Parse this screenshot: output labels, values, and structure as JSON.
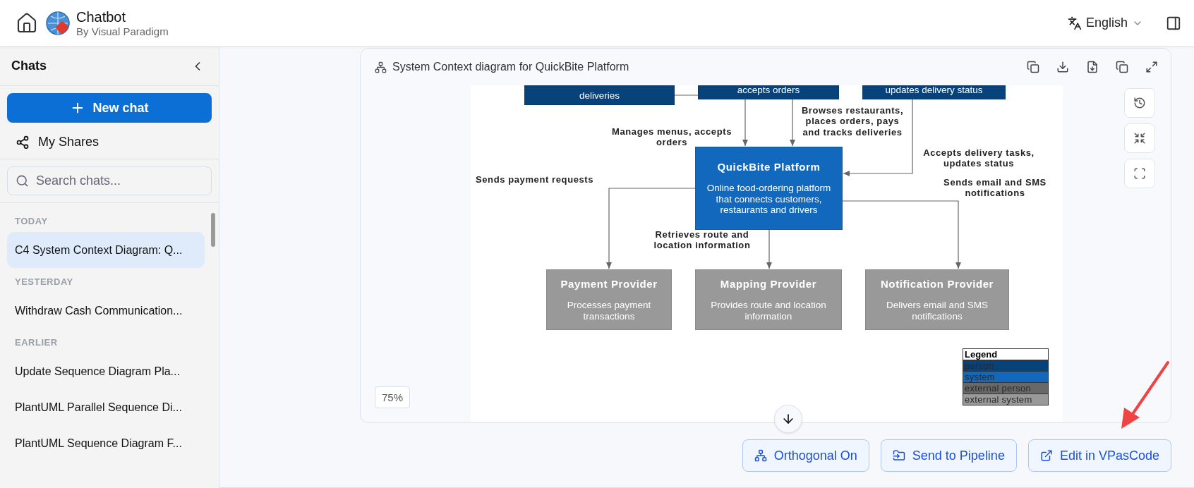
{
  "header": {
    "app_name": "Chatbot",
    "subtitle": "By Visual Paradigm",
    "language": "English"
  },
  "sidebar": {
    "title": "Chats",
    "new_chat": "New chat",
    "my_shares": "My Shares",
    "search": {
      "placeholder": "Search chats..."
    },
    "groups": [
      {
        "label": "TODAY",
        "items": [
          {
            "title": "C4 System Context Diagram: Q...",
            "selected": true
          }
        ]
      },
      {
        "label": "YESTERDAY",
        "items": [
          {
            "title": "Withdraw Cash Communication...",
            "selected": false
          }
        ]
      },
      {
        "label": "EARLIER",
        "items": [
          {
            "title": "Update Sequence Diagram Pla...",
            "selected": false
          },
          {
            "title": "PlantUML Parallel Sequence Di...",
            "selected": false
          },
          {
            "title": "PlantUML Sequence Diagram F...",
            "selected": false
          }
        ]
      }
    ]
  },
  "diagram_card": {
    "title": "System Context diagram for QuickBite Platform",
    "zoom": "75%",
    "nodes": [
      {
        "kind": "person",
        "description": "deliveries"
      },
      {
        "kind": "person",
        "description": "accepts orders"
      },
      {
        "kind": "person",
        "description": "updates delivery status"
      },
      {
        "kind": "system",
        "name": "QuickBite Platform",
        "description": "Online food-ordering platform that connects customers, restaurants and drivers"
      },
      {
        "kind": "external_system",
        "name": "Payment Provider",
        "description": "Processes payment transactions"
      },
      {
        "kind": "external_system",
        "name": "Mapping Provider",
        "description": "Provides route and location information"
      },
      {
        "kind": "external_system",
        "name": "Notification Provider",
        "description": "Delivers email and SMS notifications"
      }
    ],
    "relationships": [
      {
        "label": "Browses restaurants, places orders, pays and tracks deliveries"
      },
      {
        "label": "Manages menus, accepts orders"
      },
      {
        "label": "Accepts delivery tasks, updates status"
      },
      {
        "label": "Sends payment requests"
      },
      {
        "label": "Sends email and SMS notifications"
      },
      {
        "label": "Retrieves route and location information"
      }
    ],
    "legend": {
      "title": "Legend",
      "items": [
        {
          "label": "person",
          "color": "#08427b"
        },
        {
          "label": "system",
          "color": "#1168bd"
        },
        {
          "label": "external person",
          "color": "#686868"
        },
        {
          "label": "external system",
          "color": "#999999"
        }
      ]
    }
  },
  "actions": [
    {
      "kind": "layout",
      "label": "Orthogonal On"
    },
    {
      "kind": "pipeline",
      "label": "Send to Pipeline"
    },
    {
      "kind": "external",
      "label": "Edit in VPasCode"
    }
  ]
}
